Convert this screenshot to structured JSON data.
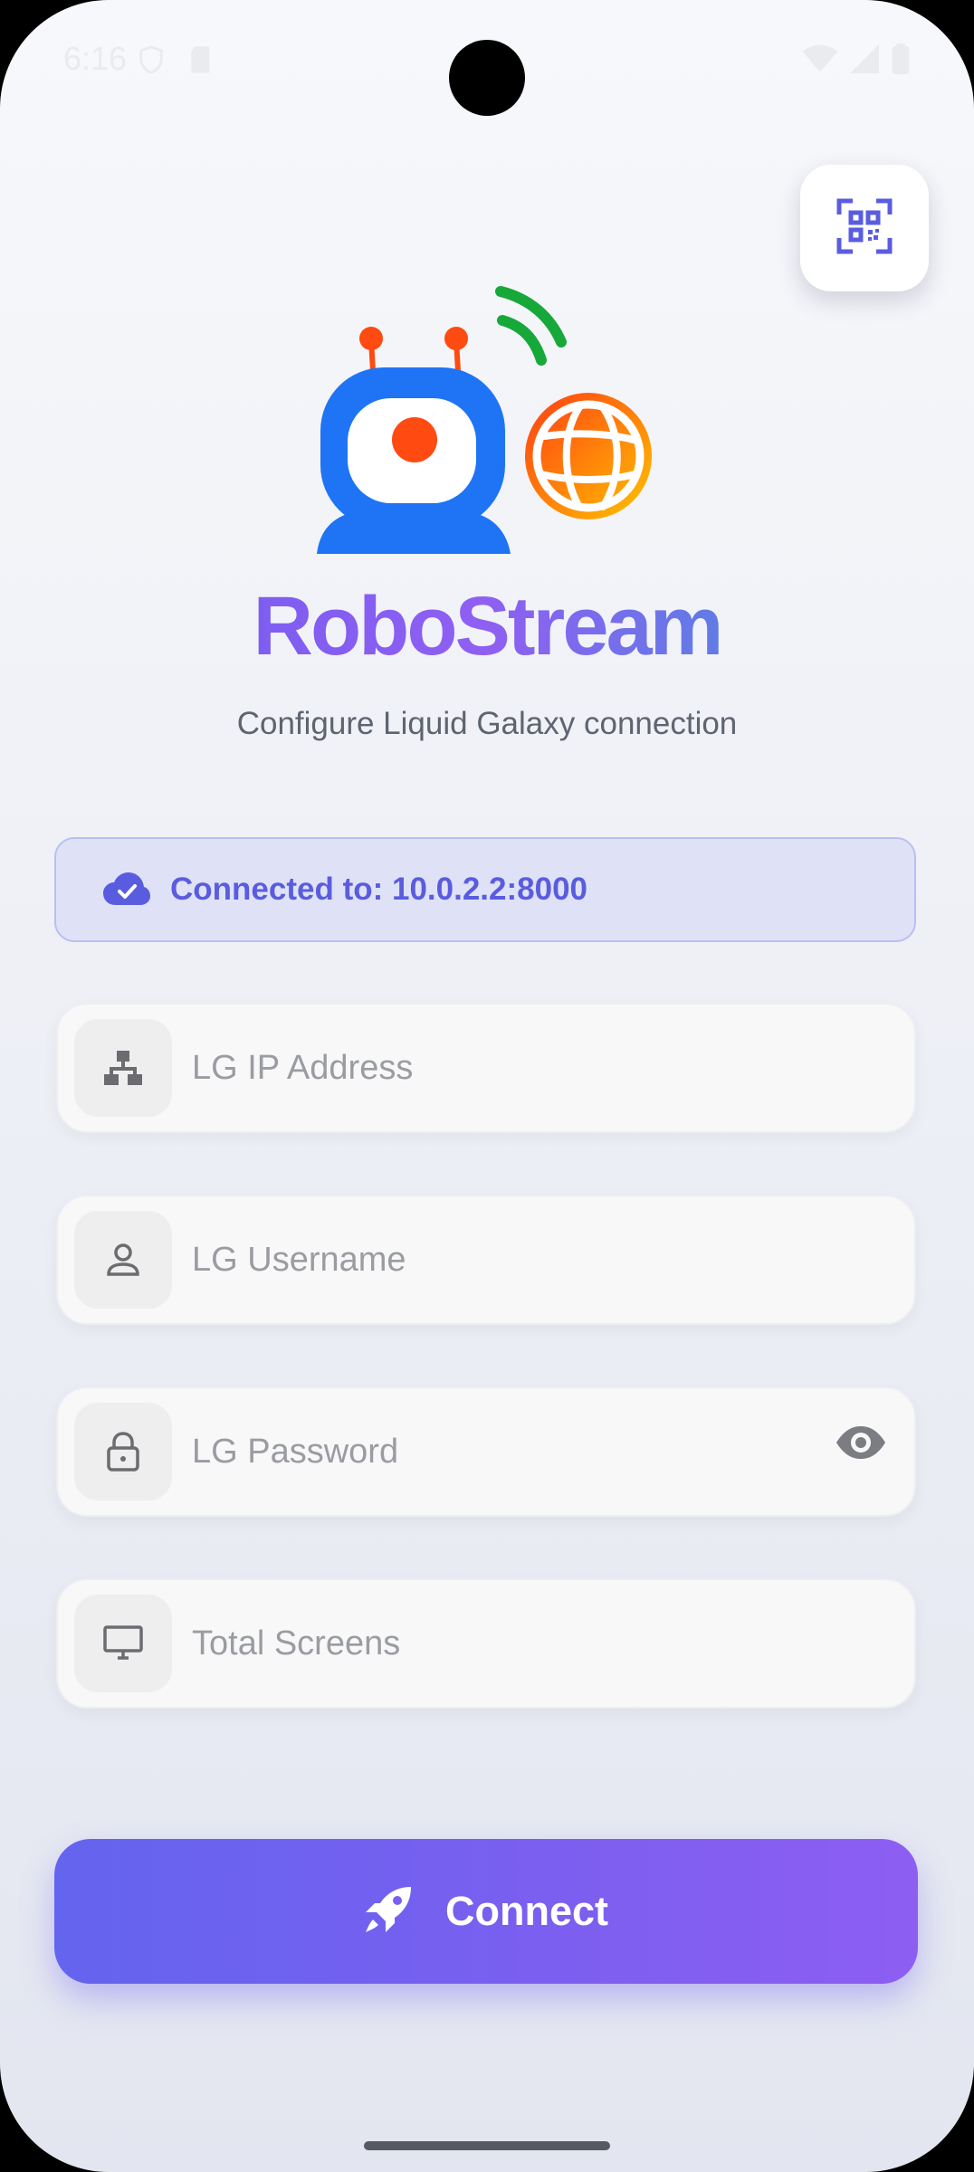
{
  "status_bar": {
    "time": "6:16",
    "icons": [
      "shield-icon",
      "sd-card-icon",
      "wifi-icon",
      "signal-icon",
      "battery-icon"
    ]
  },
  "header": {
    "qr_icon": "qr-scan-icon",
    "app_name": "RoboStream",
    "subtitle": "Configure Liquid Galaxy connection"
  },
  "connection": {
    "icon": "cloud-check-icon",
    "text": "Connected to: 10.0.2.2:8000"
  },
  "form": {
    "fields": [
      {
        "icon": "network-icon",
        "placeholder": "LG IP Address"
      },
      {
        "icon": "person-icon",
        "placeholder": "LG Username"
      },
      {
        "icon": "lock-icon",
        "placeholder": "LG Password",
        "trailing_icon": "eye-icon"
      },
      {
        "icon": "monitor-icon",
        "placeholder": "Total Screens"
      }
    ]
  },
  "connect_button": {
    "icon": "rocket-icon",
    "label": "Connect"
  },
  "colors": {
    "accent": "#6b5df0",
    "accent_end": "#8d5ef2",
    "banner_bg": "#dfe2f6",
    "banner_text": "#5a5ce0",
    "robot_blue": "#1e74f5",
    "robot_eye": "#ff4a12",
    "wifi_green": "#17a83a"
  }
}
